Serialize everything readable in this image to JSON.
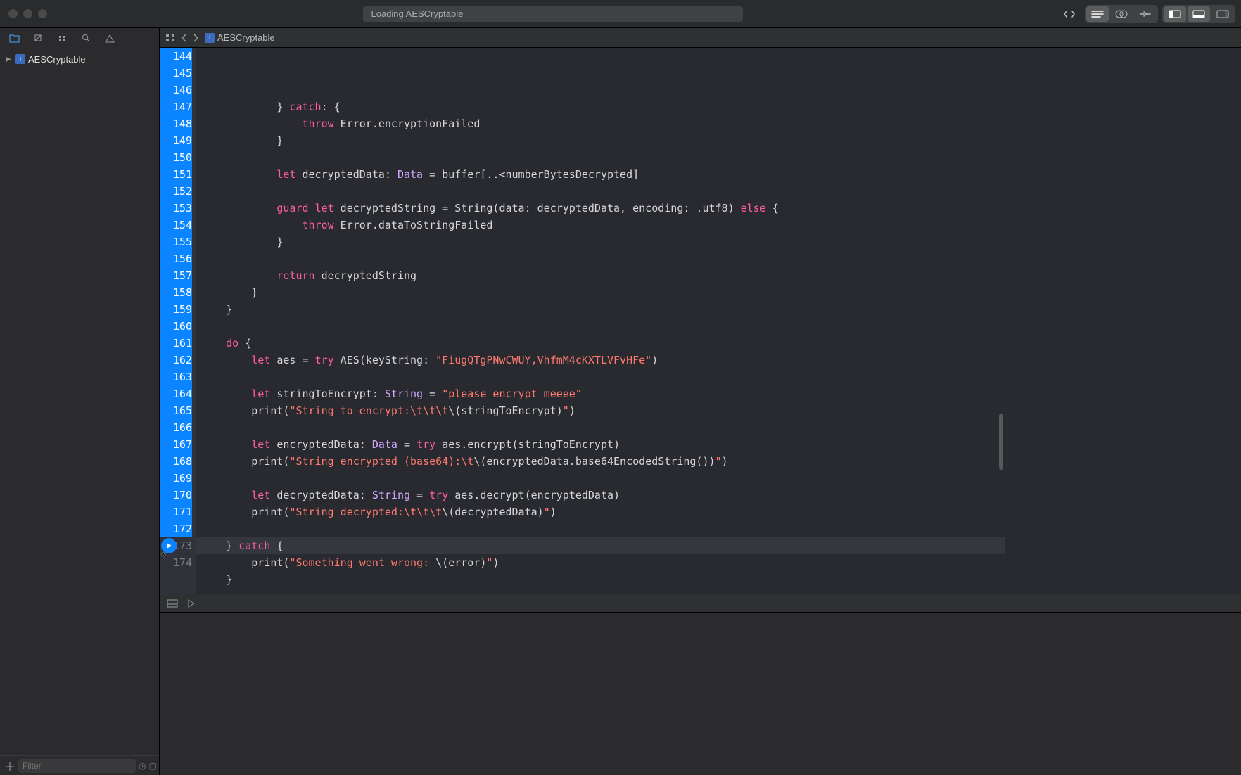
{
  "title": "Loading AESCryptable",
  "tree_item": "AESCryptable",
  "jump_bar_item": "AESCryptable",
  "filter_placeholder": "Filter",
  "line_start": 144,
  "line_end": 174,
  "code_lines": [
    {
      "n": 144,
      "t": "            } ",
      "spans": [
        [
          "kw",
          "catch"
        ],
        [
          "",
          ": {"
        ]
      ]
    },
    {
      "n": 145,
      "t": "                ",
      "spans": [
        [
          "kw",
          "throw"
        ],
        [
          "",
          " Error.encryptionFailed"
        ]
      ]
    },
    {
      "n": 146,
      "t": "            }"
    },
    {
      "n": 147,
      "t": ""
    },
    {
      "n": 148,
      "t": "            ",
      "spans": [
        [
          "kw",
          "let"
        ],
        [
          "",
          " decryptedData: "
        ],
        [
          "tname",
          "Data"
        ],
        [
          "",
          " = buffer[..<numberBytesDecrypted]"
        ]
      ]
    },
    {
      "n": 149,
      "t": ""
    },
    {
      "n": 150,
      "t": "            ",
      "spans": [
        [
          "kw",
          "guard"
        ],
        [
          "",
          " "
        ],
        [
          "kw",
          "let"
        ],
        [
          "",
          " decryptedString = String(data: decryptedData, encoding: .utf8) "
        ],
        [
          "kw",
          "else"
        ],
        [
          "",
          " {"
        ]
      ]
    },
    {
      "n": 151,
      "t": "                ",
      "spans": [
        [
          "kw",
          "throw"
        ],
        [
          "",
          " Error.dataToStringFailed"
        ]
      ]
    },
    {
      "n": 152,
      "t": "            }"
    },
    {
      "n": 153,
      "t": ""
    },
    {
      "n": 154,
      "t": "            ",
      "spans": [
        [
          "kw",
          "return"
        ],
        [
          "",
          " decryptedString"
        ]
      ]
    },
    {
      "n": 155,
      "t": "        }"
    },
    {
      "n": 156,
      "t": "    }"
    },
    {
      "n": 157,
      "t": ""
    },
    {
      "n": 158,
      "t": "    ",
      "spans": [
        [
          "kw",
          "do"
        ],
        [
          "",
          " {"
        ]
      ]
    },
    {
      "n": 159,
      "t": "        ",
      "spans": [
        [
          "kw",
          "let"
        ],
        [
          "",
          " aes = "
        ],
        [
          "kw",
          "try"
        ],
        [
          "",
          " AES(keyString: "
        ],
        [
          "str",
          "\"FiugQTgPNwCWUY,VhfmM4cKXTLVFvHFe\""
        ],
        [
          "",
          ")"
        ]
      ]
    },
    {
      "n": 160,
      "t": ""
    },
    {
      "n": 161,
      "t": "        ",
      "spans": [
        [
          "kw",
          "let"
        ],
        [
          "",
          " stringToEncrypt: "
        ],
        [
          "tname",
          "String"
        ],
        [
          "",
          " = "
        ],
        [
          "str",
          "\"please encrypt meeee\""
        ]
      ]
    },
    {
      "n": 162,
      "t": "        print(",
      "spans": [
        [
          "str",
          "\"String to encrypt:\\t\\t\\t"
        ],
        [
          "esc",
          "\\("
        ],
        [
          "",
          "stringToEncrypt"
        ],
        [
          "esc",
          ")"
        ],
        [
          "str",
          "\""
        ],
        [
          "",
          ")"
        ]
      ]
    },
    {
      "n": 163,
      "t": ""
    },
    {
      "n": 164,
      "t": "        ",
      "spans": [
        [
          "kw",
          "let"
        ],
        [
          "",
          " encryptedData: "
        ],
        [
          "tname",
          "Data"
        ],
        [
          "",
          " = "
        ],
        [
          "kw",
          "try"
        ],
        [
          "",
          " aes.encrypt(stringToEncrypt)"
        ]
      ]
    },
    {
      "n": 165,
      "t": "        print(",
      "spans": [
        [
          "str",
          "\"String encrypted (base64):\\t"
        ],
        [
          "esc",
          "\\("
        ],
        [
          "",
          "encryptedData.base64EncodedString()"
        ],
        [
          "esc",
          ")"
        ],
        [
          "str",
          "\""
        ],
        [
          "",
          ")"
        ]
      ]
    },
    {
      "n": 166,
      "t": ""
    },
    {
      "n": 167,
      "t": "        ",
      "spans": [
        [
          "kw",
          "let"
        ],
        [
          "",
          " decryptedData: "
        ],
        [
          "tname",
          "String"
        ],
        [
          "",
          " = "
        ],
        [
          "kw",
          "try"
        ],
        [
          "",
          " aes.decrypt(encryptedData)"
        ]
      ]
    },
    {
      "n": 168,
      "t": "        print(",
      "spans": [
        [
          "str",
          "\"String decrypted:\\t\\t\\t"
        ],
        [
          "esc",
          "\\("
        ],
        [
          "",
          "decryptedData"
        ],
        [
          "esc",
          ")"
        ],
        [
          "str",
          "\""
        ],
        [
          "",
          ")"
        ]
      ]
    },
    {
      "n": 169,
      "t": ""
    },
    {
      "n": 170,
      "t": "    } ",
      "spans": [
        [
          "kw",
          "catch"
        ],
        [
          "",
          " {"
        ]
      ]
    },
    {
      "n": 171,
      "t": "        print(",
      "spans": [
        [
          "str",
          "\"Something went wrong: "
        ],
        [
          "esc",
          "\\("
        ],
        [
          "",
          "error"
        ],
        [
          "esc",
          ")"
        ],
        [
          "str",
          "\""
        ],
        [
          "",
          ")"
        ]
      ]
    },
    {
      "n": 172,
      "t": "    }"
    },
    {
      "n": 173,
      "t": "",
      "current": true,
      "run": true
    },
    {
      "n": 174,
      "t": ""
    }
  ]
}
